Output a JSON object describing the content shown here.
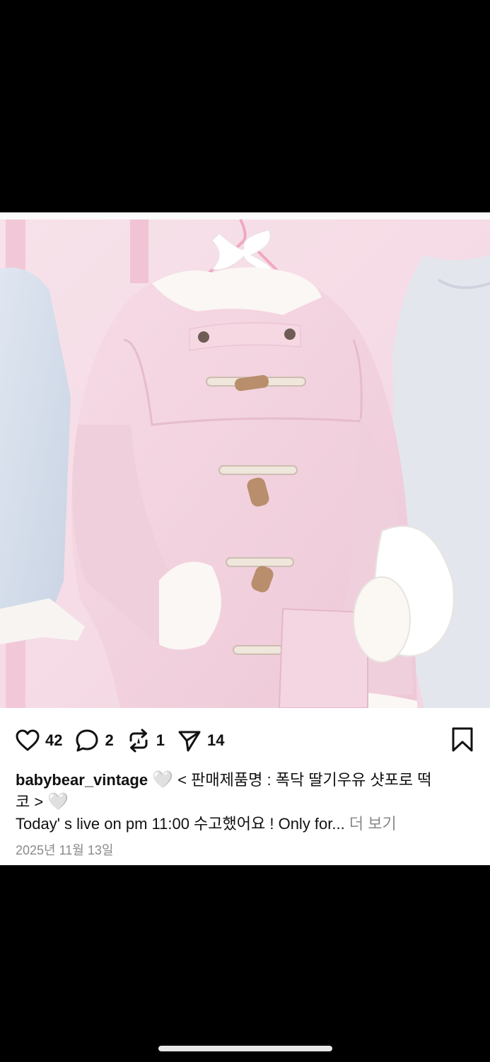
{
  "actions": {
    "like": {
      "icon": "heart-icon",
      "count": "42"
    },
    "comment": {
      "icon": "comment-bubble-icon",
      "count": "2"
    },
    "repost": {
      "icon": "repost-icon",
      "count": "1"
    },
    "share": {
      "icon": "send-icon",
      "count": "14"
    },
    "save": {
      "icon": "bookmark-icon"
    }
  },
  "post": {
    "username": "babybear_vintage",
    "heart_emoji": "🤍",
    "caption_line1": "< 판매제품명 : 폭닥 딸기우유 샷포로 떡",
    "caption_line1_end": "코 >",
    "caption_line2": "Today' s live on pm 11:00 수고했어요 ! Only for...",
    "more_label": "더 보기",
    "date": "2025년 11월 13일"
  },
  "colors": {
    "coat_pink": "#f3d3e0",
    "wall_pink": "#f6dde7",
    "text": "#111111",
    "muted": "#8a8a8a"
  }
}
